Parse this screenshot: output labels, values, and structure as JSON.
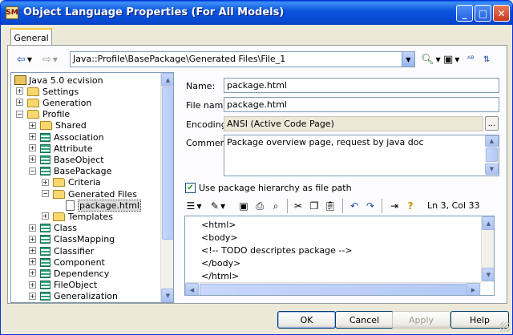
{
  "window": {
    "title": "Object Language Properties (For All Models)",
    "icon_text": "SM",
    "controls": {
      "minimize": "_",
      "maximize": "□",
      "close": "✕"
    }
  },
  "tabs": [
    {
      "label": "General",
      "active": true
    }
  ],
  "nav": {
    "back_glyph": "⇦",
    "forward_glyph": "⇨",
    "path": "Java::Profile\\BasePackage\\Generated Files\\File_1",
    "icons": [
      "back-icon",
      "forward-icon",
      "find-icon",
      "save-icon",
      "spell-check-icon",
      "sort-icon"
    ]
  },
  "tree": {
    "items": [
      {
        "label": "Java 5.0 ecvision",
        "kind": "root",
        "expander": "−"
      },
      {
        "label": "Settings",
        "kind": "folder",
        "expander": "+"
      },
      {
        "label": "Generation",
        "kind": "folder",
        "expander": "+"
      },
      {
        "label": "Profile",
        "kind": "folder",
        "expander": "−"
      },
      {
        "label": "Shared",
        "kind": "folder",
        "expander": "+"
      },
      {
        "label": "Association",
        "kind": "class",
        "expander": "+"
      },
      {
        "label": "Attribute",
        "kind": "class",
        "expander": "+"
      },
      {
        "label": "BaseObject",
        "kind": "class",
        "expander": "+"
      },
      {
        "label": "BasePackage",
        "kind": "class",
        "expander": "−"
      },
      {
        "label": "Criteria",
        "kind": "folder",
        "expander": "+"
      },
      {
        "label": "Generated Files",
        "kind": "folder",
        "expander": "−"
      },
      {
        "label": "package.html",
        "kind": "file",
        "expander": "",
        "selected": true
      },
      {
        "label": "Templates",
        "kind": "folder",
        "expander": "+"
      },
      {
        "label": "Class",
        "kind": "class",
        "expander": "+"
      },
      {
        "label": "ClassMapping",
        "kind": "class",
        "expander": "+"
      },
      {
        "label": "Classifier",
        "kind": "class",
        "expander": "+"
      },
      {
        "label": "Component",
        "kind": "class",
        "expander": "+"
      },
      {
        "label": "Dependency",
        "kind": "class",
        "expander": "+"
      },
      {
        "label": "FileObject",
        "kind": "class",
        "expander": "+"
      },
      {
        "label": "Generalization",
        "kind": "class",
        "expander": "+"
      }
    ]
  },
  "form": {
    "name_label": "Name:",
    "name_value": "package.html",
    "filename_label": "File name:",
    "filename_value": "package.html",
    "encoding_label": "Encoding:",
    "encoding_value": "ANSI (Active Code Page)",
    "encoding_button": "...",
    "comment_label": "Comment:",
    "comment_value": "Package overview page, request by java doc",
    "hierarchy_checkbox_label": "Use package hierarchy as file path",
    "hierarchy_checked": true
  },
  "editor_toolbar": {
    "cursor_position": "Ln 3, Col 33"
  },
  "editor": {
    "lines": [
      "<html>",
      "<body>",
      "<!-- TODO descriptes package -->",
      "</body>",
      "</html>"
    ]
  },
  "buttons": {
    "ok": "OK",
    "cancel": "Cancel",
    "apply": "Apply",
    "help": "Help"
  },
  "colors": {
    "titlebar": "#0b56e0",
    "window_bg": "#ece9d8",
    "selection": "#dcdcdc"
  }
}
